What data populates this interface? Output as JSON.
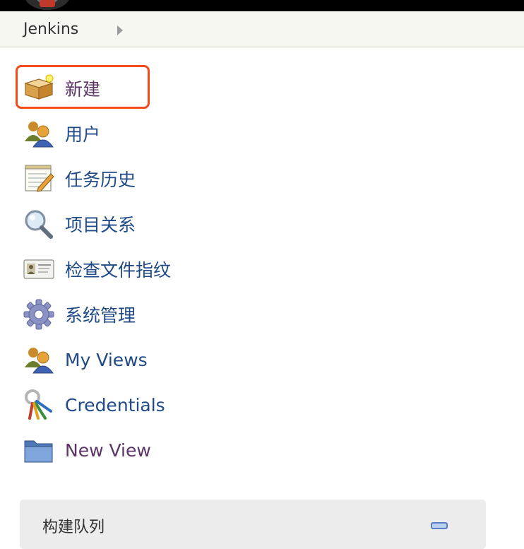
{
  "header": {
    "breadcrumb_root": "Jenkins"
  },
  "tasks": [
    {
      "label": "新建",
      "icon": "new-item-box-icon",
      "visited": true,
      "highlighted": true
    },
    {
      "label": "用户",
      "icon": "users-icon",
      "visited": false
    },
    {
      "label": "任务历史",
      "icon": "notepad-history-icon",
      "visited": false
    },
    {
      "label": "项目关系",
      "icon": "magnifier-icon",
      "visited": false
    },
    {
      "label": "检查文件指纹",
      "icon": "id-card-fingerprint-icon",
      "visited": false
    },
    {
      "label": "系统管理",
      "icon": "gear-icon",
      "visited": false
    },
    {
      "label": "My Views",
      "icon": "users-icon",
      "visited": false
    },
    {
      "label": "Credentials",
      "icon": "keys-icon",
      "visited": false
    },
    {
      "label": "New View",
      "icon": "folder-icon",
      "visited": true
    }
  ],
  "build_queue": {
    "title": "构建队列"
  },
  "colors": {
    "link": "#204a87",
    "visited_link": "#5c3566",
    "highlight_border": "#f24c1e"
  }
}
